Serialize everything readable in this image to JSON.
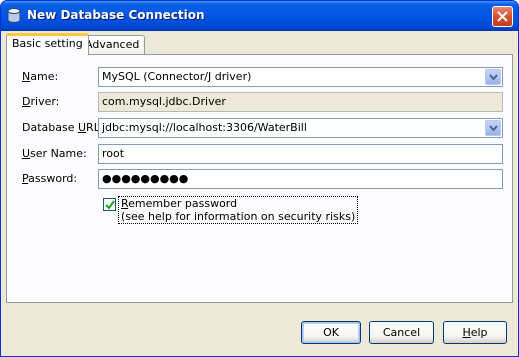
{
  "window": {
    "title": "New Database Connection",
    "icon": "database-connection-icon"
  },
  "tabs": [
    {
      "label": "Basic setting",
      "active": true
    },
    {
      "label": "Advanced",
      "active": false
    }
  ],
  "form": {
    "name": {
      "label": "Name:",
      "mnemonic": "N",
      "rest": "ame:",
      "value": "MySQL (Connector/J driver)"
    },
    "driver": {
      "label": "Driver:",
      "mnemonic": "D",
      "rest": "river:",
      "value": "com.mysql.jdbc.Driver"
    },
    "database_url": {
      "label": "Database URL:",
      "pre": "Database ",
      "mnemonic": "U",
      "rest": "RL:",
      "value": "jdbc:mysql://localhost:3306/WaterBill"
    },
    "user_name": {
      "label": "User Name:",
      "mnemonic": "U",
      "rest": "ser Name:",
      "value": "root"
    },
    "password": {
      "label": "Password:",
      "mnemonic": "P",
      "rest": "assword:",
      "value": "●●●●●●●●●"
    },
    "remember": {
      "checked": true,
      "line1_mnemonic": "R",
      "line1_rest": "emember password",
      "line2": "(see help for information on security risks)"
    }
  },
  "buttons": {
    "ok": "OK",
    "cancel": "Cancel",
    "help_mnemonic": "H",
    "help_rest": "elp"
  },
  "colors": {
    "title_bar": "#0055e5",
    "dialog_bg": "#ece9d8",
    "tab_highlight": "#ffc83c",
    "field_border": "#7f9db9"
  }
}
